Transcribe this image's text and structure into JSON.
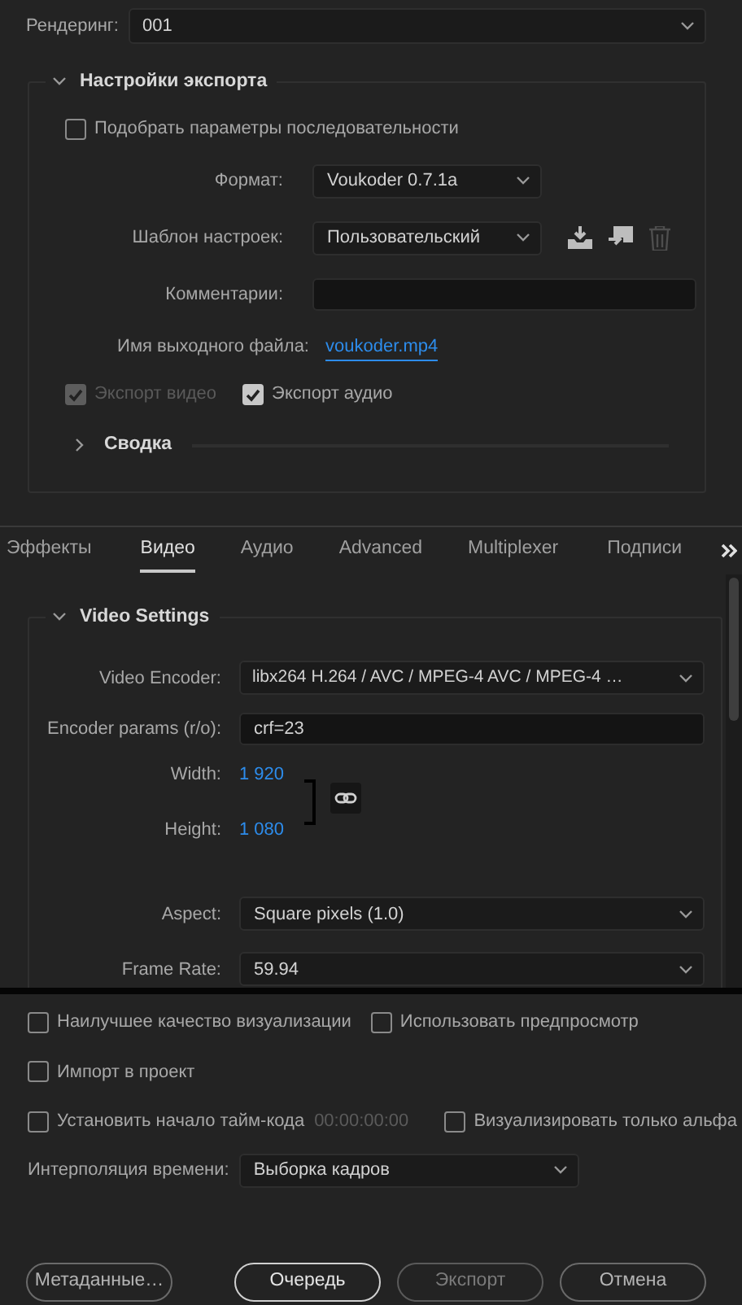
{
  "render": {
    "label": "Рендеринг:",
    "value": "001"
  },
  "export_settings": {
    "title": "Настройки экспорта",
    "expanded": true,
    "match_sequence": {
      "label": "Подобрать параметры последовательности",
      "checked": false
    },
    "format": {
      "label": "Формат:",
      "value": "Voukoder 0.7.1a"
    },
    "preset": {
      "label": "Шаблон настроек:",
      "value": "Пользовательский"
    },
    "comments": {
      "label": "Комментарии:"
    },
    "output": {
      "label": "Имя выходного файла:",
      "value": "voukoder.mp4"
    },
    "export_toggles": [
      {
        "label": "Экспорт видео",
        "checked": true,
        "disabled": true
      },
      {
        "label": "Экспорт аудио",
        "checked": true,
        "disabled": false
      }
    ],
    "summary": {
      "title": "Сводка",
      "expanded": false
    }
  },
  "tabs": [
    {
      "label": "Эффекты",
      "selected": false
    },
    {
      "label": "Видео",
      "selected": true
    },
    {
      "label": "Аудио",
      "selected": false
    },
    {
      "label": "Advanced",
      "selected": false
    },
    {
      "label": "Multiplexer",
      "selected": false
    },
    {
      "label": "Подписи",
      "selected": false
    }
  ],
  "video_settings": {
    "title": "Video Settings",
    "expanded": true,
    "encoder": {
      "label": "Video Encoder:",
      "value": "libx264 H.264 / AVC / MPEG-4 AVC / MPEG-4 …"
    },
    "params": {
      "label": "Encoder params (r/o):",
      "value": "crf=23"
    },
    "width": {
      "label": "Width:",
      "value": "1 920"
    },
    "height": {
      "label": "Height:",
      "value": "1 080"
    },
    "aspect": {
      "label": "Aspect:",
      "value": "Square pixels (1.0)"
    },
    "frame_rate": {
      "label": "Frame Rate:",
      "value": "59.94"
    }
  },
  "options": [
    {
      "label": "Наилучшее качество визуализации",
      "checked": false
    },
    {
      "label": "Использовать предпросмотр",
      "checked": false
    },
    {
      "label": "Импорт в проект",
      "checked": false
    },
    {
      "label": "Установить начало тайм-кода",
      "checked": false
    },
    {
      "label": "Визуализировать только альфа",
      "checked": false
    }
  ],
  "timecode": "00:00:00:00",
  "time_interpolation": {
    "label": "Интерполяция времени:",
    "value": "Выборка кадров"
  },
  "buttons": [
    {
      "label": "Метаданные…",
      "focused": false,
      "disabled": false
    },
    {
      "label": "Очередь",
      "focused": true,
      "disabled": false
    },
    {
      "label": "Экспорт",
      "focused": false,
      "disabled": true
    },
    {
      "label": "Отмена",
      "focused": false,
      "disabled": false
    }
  ]
}
